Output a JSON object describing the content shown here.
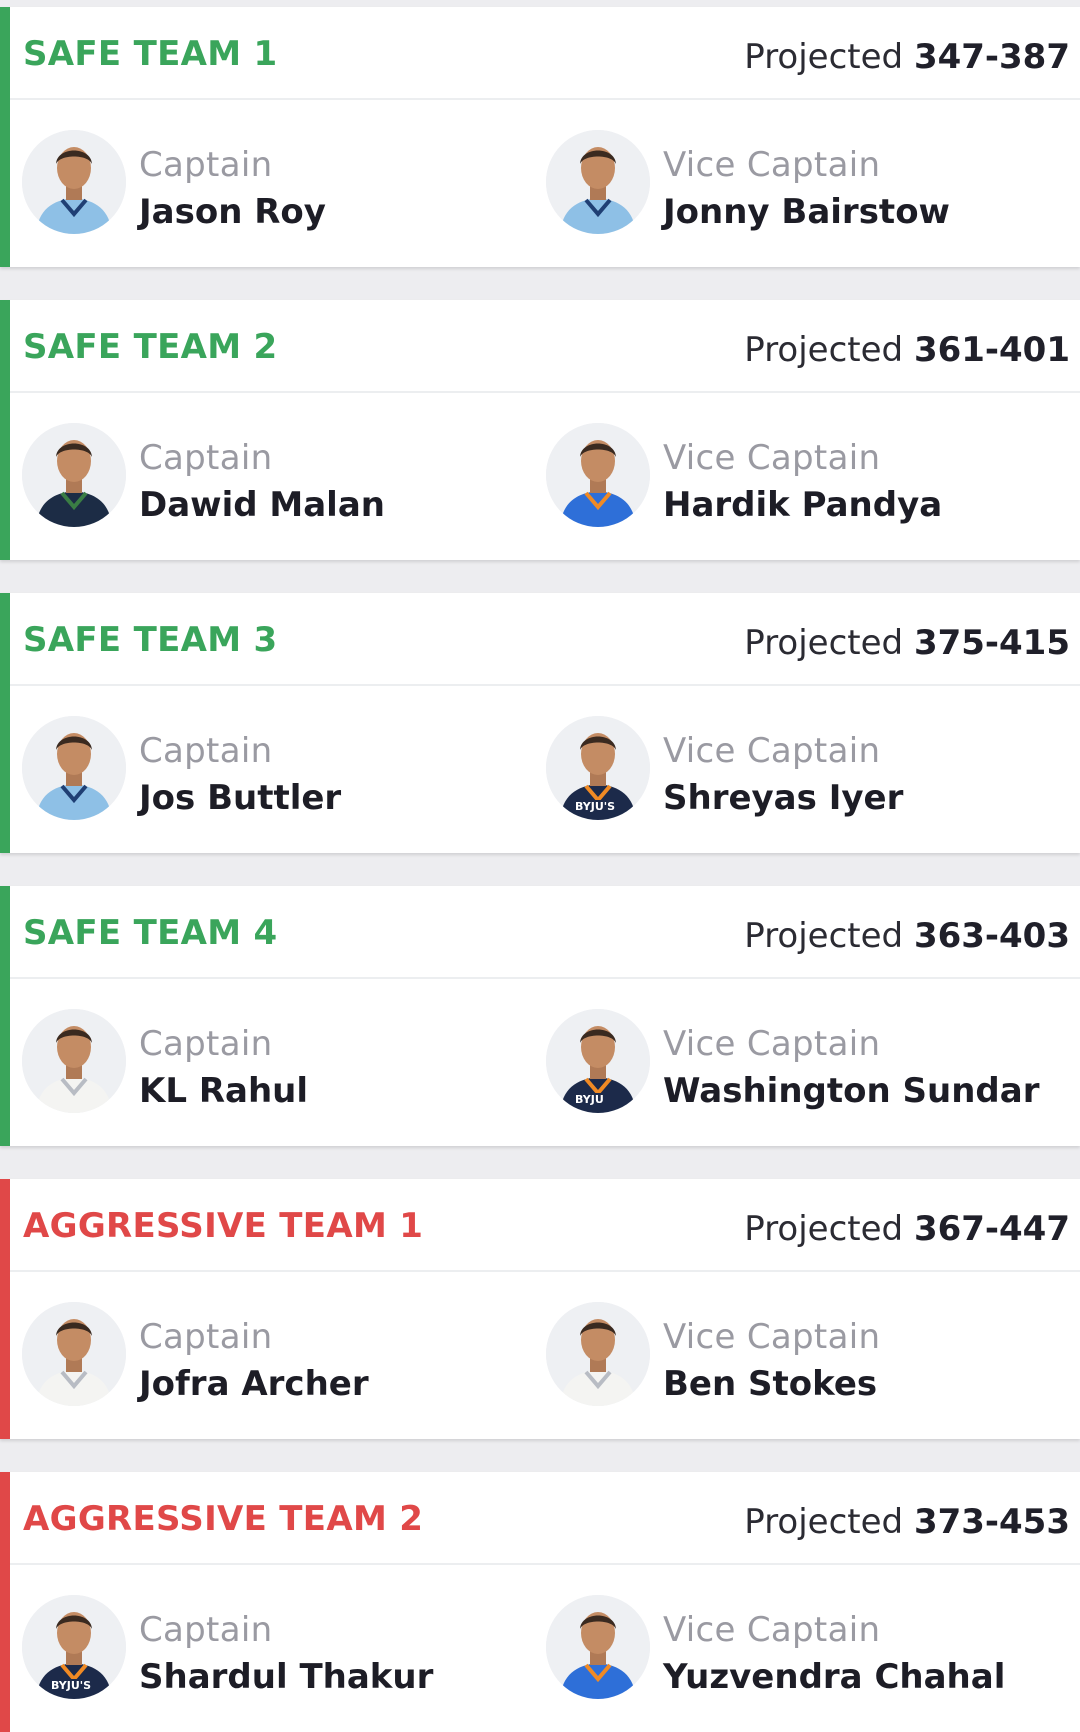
{
  "labels": {
    "projected": "Projected",
    "captain": "Captain",
    "vice_captain": "Vice Captain"
  },
  "colors": {
    "safe": "#3aa55b",
    "aggressive": "#e04848"
  },
  "teams": [
    {
      "name": "SAFE TEAM 1",
      "type": "safe",
      "projected": "347-387",
      "captain": {
        "name": "Jason Roy",
        "kit": "england-blue"
      },
      "vice_captain": {
        "name": "Jonny Bairstow",
        "kit": "england-blue"
      }
    },
    {
      "name": "SAFE TEAM 2",
      "type": "safe",
      "projected": "361-401",
      "captain": {
        "name": "Dawid Malan",
        "kit": "england-navy"
      },
      "vice_captain": {
        "name": "Hardik Pandya",
        "kit": "india-blue"
      }
    },
    {
      "name": "SAFE TEAM 3",
      "type": "safe",
      "projected": "375-415",
      "captain": {
        "name": "Jos Buttler",
        "kit": "england-blue"
      },
      "vice_captain": {
        "name": "Shreyas Iyer",
        "kit": "india-navy",
        "badge": "BYJU'S"
      }
    },
    {
      "name": "SAFE TEAM 4",
      "type": "safe",
      "projected": "363-403",
      "captain": {
        "name": "KL Rahul",
        "kit": "test-white"
      },
      "vice_captain": {
        "name": "Washington Sundar",
        "kit": "india-navy",
        "badge": "BYJU"
      }
    },
    {
      "name": "AGGRESSIVE TEAM 1",
      "type": "aggressive",
      "projected": "367-447",
      "captain": {
        "name": "Jofra Archer",
        "kit": "test-white"
      },
      "vice_captain": {
        "name": "Ben Stokes",
        "kit": "test-white"
      }
    },
    {
      "name": "AGGRESSIVE TEAM 2",
      "type": "aggressive",
      "projected": "373-453",
      "captain": {
        "name": "Shardul Thakur",
        "kit": "india-navy",
        "badge": "BYJU'S"
      },
      "vice_captain": {
        "name": "Yuzvendra Chahal",
        "kit": "india-blue"
      }
    }
  ]
}
